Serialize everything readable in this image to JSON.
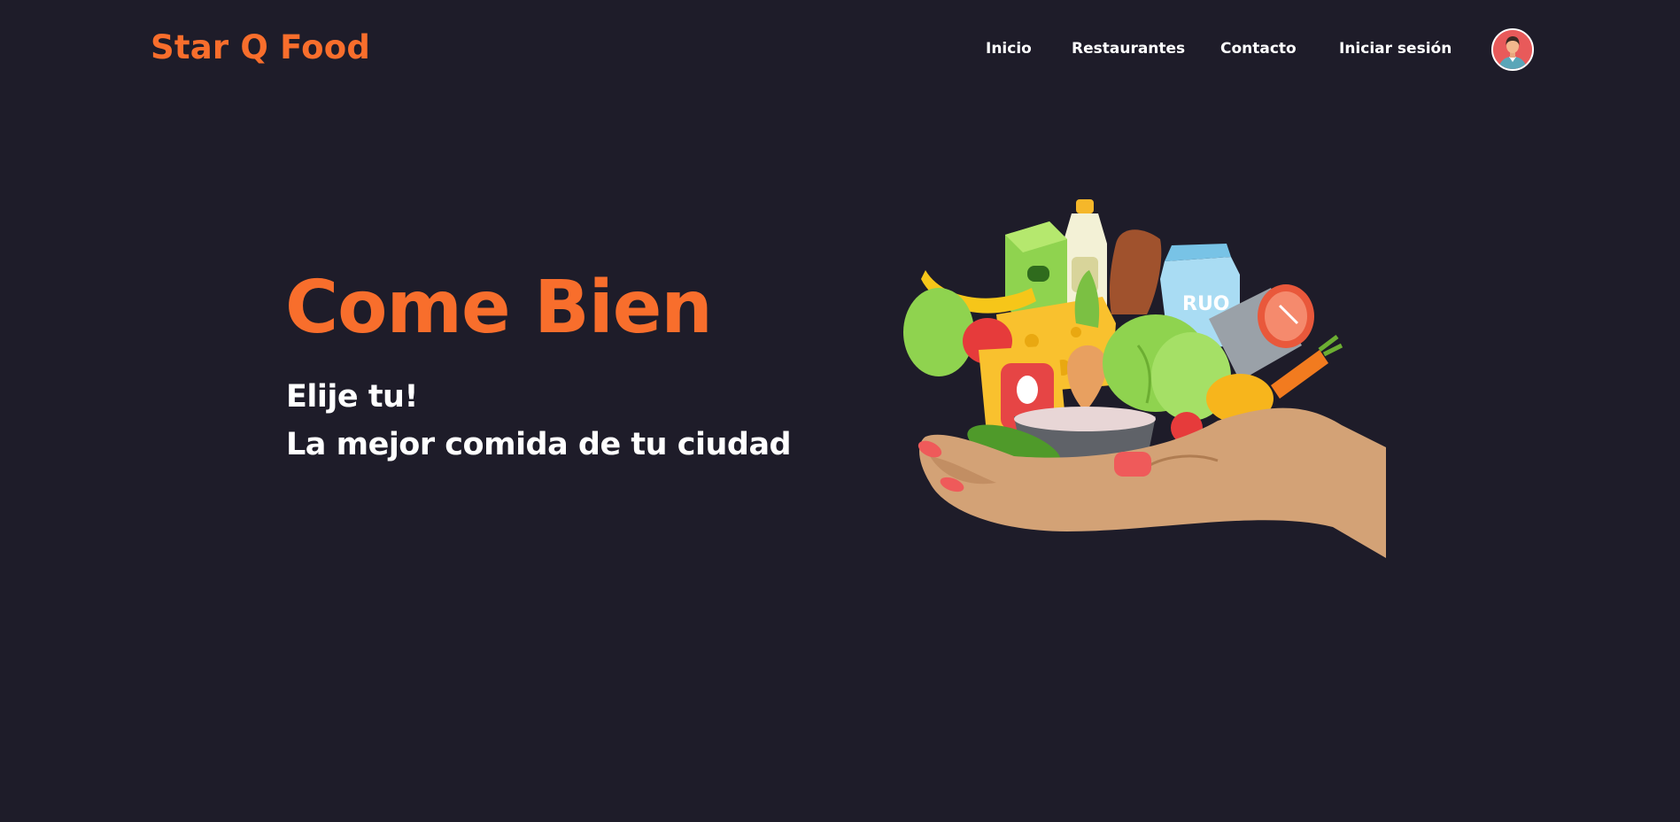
{
  "brand": {
    "name": "Star Q Food",
    "accent_color": "#f86e2c",
    "background_color": "#1e1c29"
  },
  "nav": {
    "links": [
      {
        "label": "Inicio"
      },
      {
        "label": "Restaurantes"
      },
      {
        "label": "Contacto"
      },
      {
        "label": "Iniciar sesión"
      }
    ],
    "avatar_icon": "user-avatar-icon"
  },
  "hero": {
    "title": "Come Bien",
    "line1": "Elije tu!",
    "line2": "La mejor comida de tu ciudad",
    "image_icon": "hand-holding-groceries-illustration"
  }
}
